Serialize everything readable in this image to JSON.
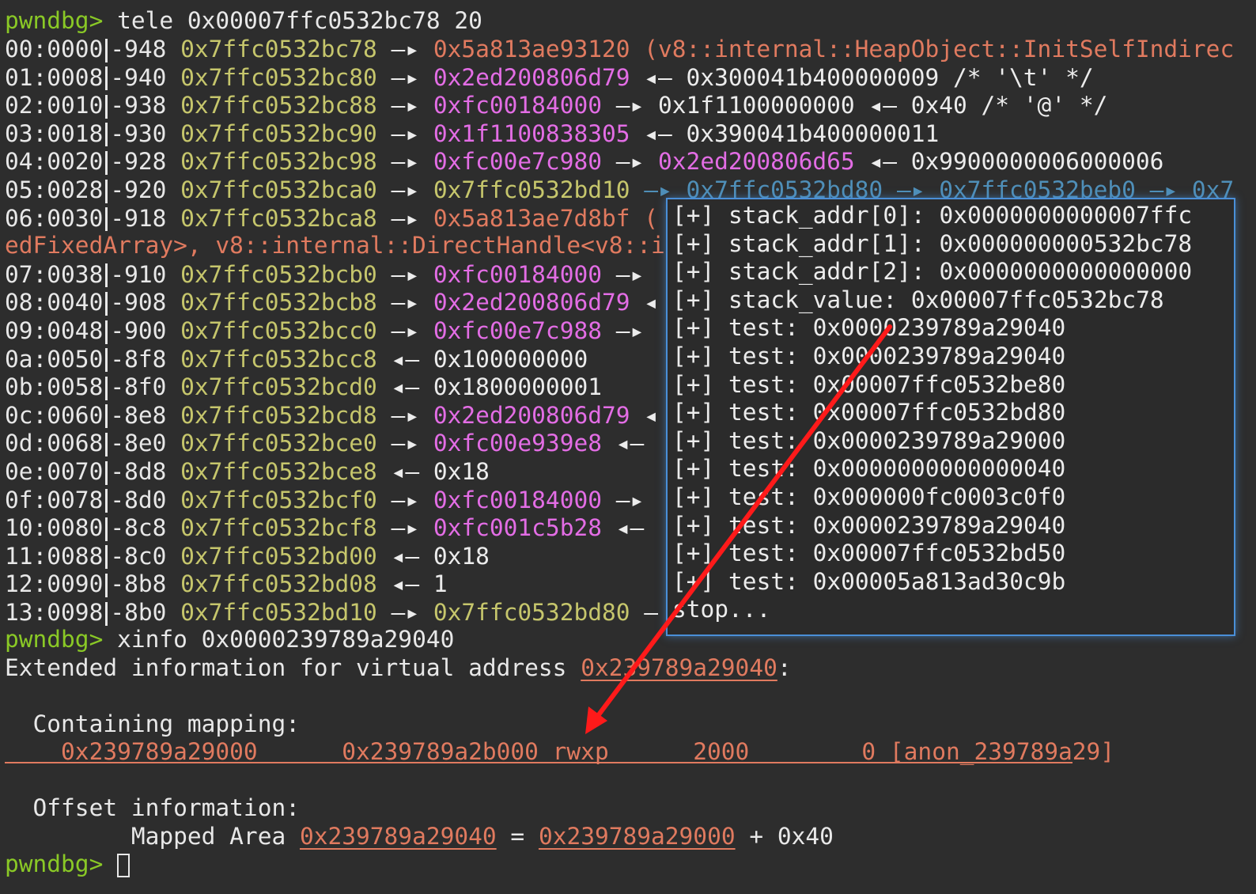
{
  "prompt": "pwndbg>",
  "cmd1": "tele 0x00007ffc0532bc78 20",
  "rows": [
    {
      "idx": "00:0000",
      "off": "-948",
      "addr": "0x7ffc0532bc78",
      "a1": " —▸ ",
      "v1": "0x5a813ae93120",
      "v1c": "heap",
      "rest": " (v8::internal::HeapObject::InitSelfIndirec",
      "restc": "heap"
    },
    {
      "idx": "01:0008",
      "off": "-940",
      "addr": "0x7ffc0532bc80",
      "a1": " —▸ ",
      "v1": "0x2ed200806d79",
      "v1c": "mag",
      "rest": " ◂— 0x300041b400000009 /* '\\t' */",
      "restc": "wht"
    },
    {
      "idx": "02:0010",
      "off": "-938",
      "addr": "0x7ffc0532bc88",
      "a1": " —▸ ",
      "v1": "0xfc00184000",
      "v1c": "mag",
      "rest": " —▸ 0x1f1100000000 ◂— 0x40 /* '@' */",
      "restc": "wht"
    },
    {
      "idx": "03:0018",
      "off": "-930",
      "addr": "0x7ffc0532bc90",
      "a1": " —▸ ",
      "v1": "0x1f1100838305",
      "v1c": "mag",
      "rest": " ◂— 0x390041b400000011",
      "restc": "wht"
    },
    {
      "idx": "04:0020",
      "off": "-928",
      "addr": "0x7ffc0532bc98",
      "a1": " —▸ ",
      "v1": "0xfc00e7c980",
      "v1c": "mag",
      "rest": " —▸ ",
      "restc": "wht",
      "v2": "0x2ed200806d65",
      "v2c": "mag",
      "rest2": " ◂— 0x9900000006000006",
      "rest2c": "wht"
    },
    {
      "idx": "05:0028",
      "off": "-920",
      "addr": "0x7ffc0532bca0",
      "a1": " —▸ ",
      "v1": "0x7ffc0532bd10",
      "v1c": "addr",
      "rest": " —▸ 0x7ffc0532bd80 —▸ 0x7ffc0532beb0 —▸ 0x7",
      "restc": "cyan"
    },
    {
      "idx": "06:0030",
      "off": "-918",
      "addr": "0x7ffc0532bca8",
      "a1": " —▸ ",
      "v1": "0x5a813ae7d8bf",
      "v1c": "heap",
      "rest": " (",
      "restc": "heap"
    },
    {
      "idx": "07:0038",
      "off": "-910",
      "addr": "0x7ffc0532bcb0",
      "a1": " —▸ ",
      "v1": "0xfc00184000",
      "v1c": "mag",
      "rest": " —▸",
      "restc": "wht"
    },
    {
      "idx": "08:0040",
      "off": "-908",
      "addr": "0x7ffc0532bcb8",
      "a1": " —▸ ",
      "v1": "0x2ed200806d79",
      "v1c": "mag",
      "rest": " ◂",
      "restc": "wht"
    },
    {
      "idx": "09:0048",
      "off": "-900",
      "addr": "0x7ffc0532bcc0",
      "a1": " —▸ ",
      "v1": "0xfc00e7c988",
      "v1c": "mag",
      "rest": " —▸",
      "restc": "wht"
    },
    {
      "idx": "0a:0050",
      "off": "-8f8",
      "addr": "0x7ffc0532bcc8",
      "a1": " ◂— ",
      "v1": "0x100000000",
      "v1c": "wht",
      "rest": "",
      "restc": "wht"
    },
    {
      "idx": "0b:0058",
      "off": "-8f0",
      "addr": "0x7ffc0532bcd0",
      "a1": " ◂— ",
      "v1": "0x1800000001",
      "v1c": "wht",
      "rest": "",
      "restc": "wht"
    },
    {
      "idx": "0c:0060",
      "off": "-8e8",
      "addr": "0x7ffc0532bcd8",
      "a1": " —▸ ",
      "v1": "0x2ed200806d79",
      "v1c": "mag",
      "rest": " ◂",
      "restc": "wht"
    },
    {
      "idx": "0d:0068",
      "off": "-8e0",
      "addr": "0x7ffc0532bce0",
      "a1": " —▸ ",
      "v1": "0xfc00e939e8",
      "v1c": "mag",
      "rest": " ◂—",
      "restc": "wht"
    },
    {
      "idx": "0e:0070",
      "off": "-8d8",
      "addr": "0x7ffc0532bce8",
      "a1": " ◂— ",
      "v1": "0x18",
      "v1c": "wht",
      "rest": "",
      "restc": "wht"
    },
    {
      "idx": "0f:0078",
      "off": "-8d0",
      "addr": "0x7ffc0532bcf0",
      "a1": " —▸ ",
      "v1": "0xfc00184000",
      "v1c": "mag",
      "rest": " —▸",
      "restc": "wht"
    },
    {
      "idx": "10:0080",
      "off": "-8c8",
      "addr": "0x7ffc0532bcf8",
      "a1": " —▸ ",
      "v1": "0xfc001c5b28",
      "v1c": "mag",
      "rest": " ◂—",
      "restc": "wht"
    },
    {
      "idx": "11:0088",
      "off": "-8c0",
      "addr": "0x7ffc0532bd00",
      "a1": " ◂— ",
      "v1": "0x18",
      "v1c": "wht",
      "rest": "",
      "restc": "wht"
    },
    {
      "idx": "12:0090",
      "off": "-8b8",
      "addr": "0x7ffc0532bd08",
      "a1": " ◂— ",
      "v1": "1",
      "v1c": "wht",
      "rest": "",
      "restc": "wht"
    },
    {
      "idx": "13:0098",
      "off": "-8b0",
      "addr": "0x7ffc0532bd10",
      "a1": " —▸ ",
      "v1": "0x7ffc0532bd80",
      "v1c": "addr",
      "rest": " —",
      "restc": "wht"
    }
  ],
  "wrap_line": "edFixedArray>, v8::internal::DirectHandle<v8::i",
  "cmd2": "xinfo 0x0000239789a29040",
  "ext_prefix": "Extended information for virtual address ",
  "ext_addr": "0x239789a29040",
  "ext_suffix": ":",
  "containing_label": "  Containing mapping:",
  "mapping_line": "    0x239789a29000      0x239789a2b000 rwxp      2000        0 [anon_239789a29]",
  "offset_label": "  Offset information:",
  "mapped_prefix": "         Mapped Area ",
  "mapped_addr": "0x239789a29040",
  "mapped_eq": " = ",
  "mapped_base": "0x239789a29000",
  "mapped_plus": " + 0x40",
  "overlay_lines": [
    "[+] stack_addr[0]: 0x0000000000007ffc",
    "[+] stack_addr[1]: 0x000000000532bc78",
    "[+] stack_addr[2]: 0x0000000000000000",
    "[+] stack_value: 0x00007ffc0532bc78",
    "[+] test: 0x0000239789a29040",
    "[+] test: 0x0000239789a29040",
    "[+] test: 0x00007ffc0532be80",
    "[+] test: 0x00007ffc0532bd80",
    "[+] test: 0x0000239789a29000",
    "[+] test: 0x0000000000000040",
    "[+] test: 0x000000fc0003c0f0",
    "[+] test: 0x0000239789a29040",
    "[+] test: 0x00007ffc0532bd50",
    "[+] test: 0x00005a813ad30c9b",
    "stop..."
  ],
  "colors": {
    "prompt": "#8ac926",
    "address": "#c6c66c",
    "heap": "#e07a5f",
    "magenta": "#e36de5",
    "arrow": "#ff1a1a",
    "overlay_border": "#4a8fd8"
  }
}
